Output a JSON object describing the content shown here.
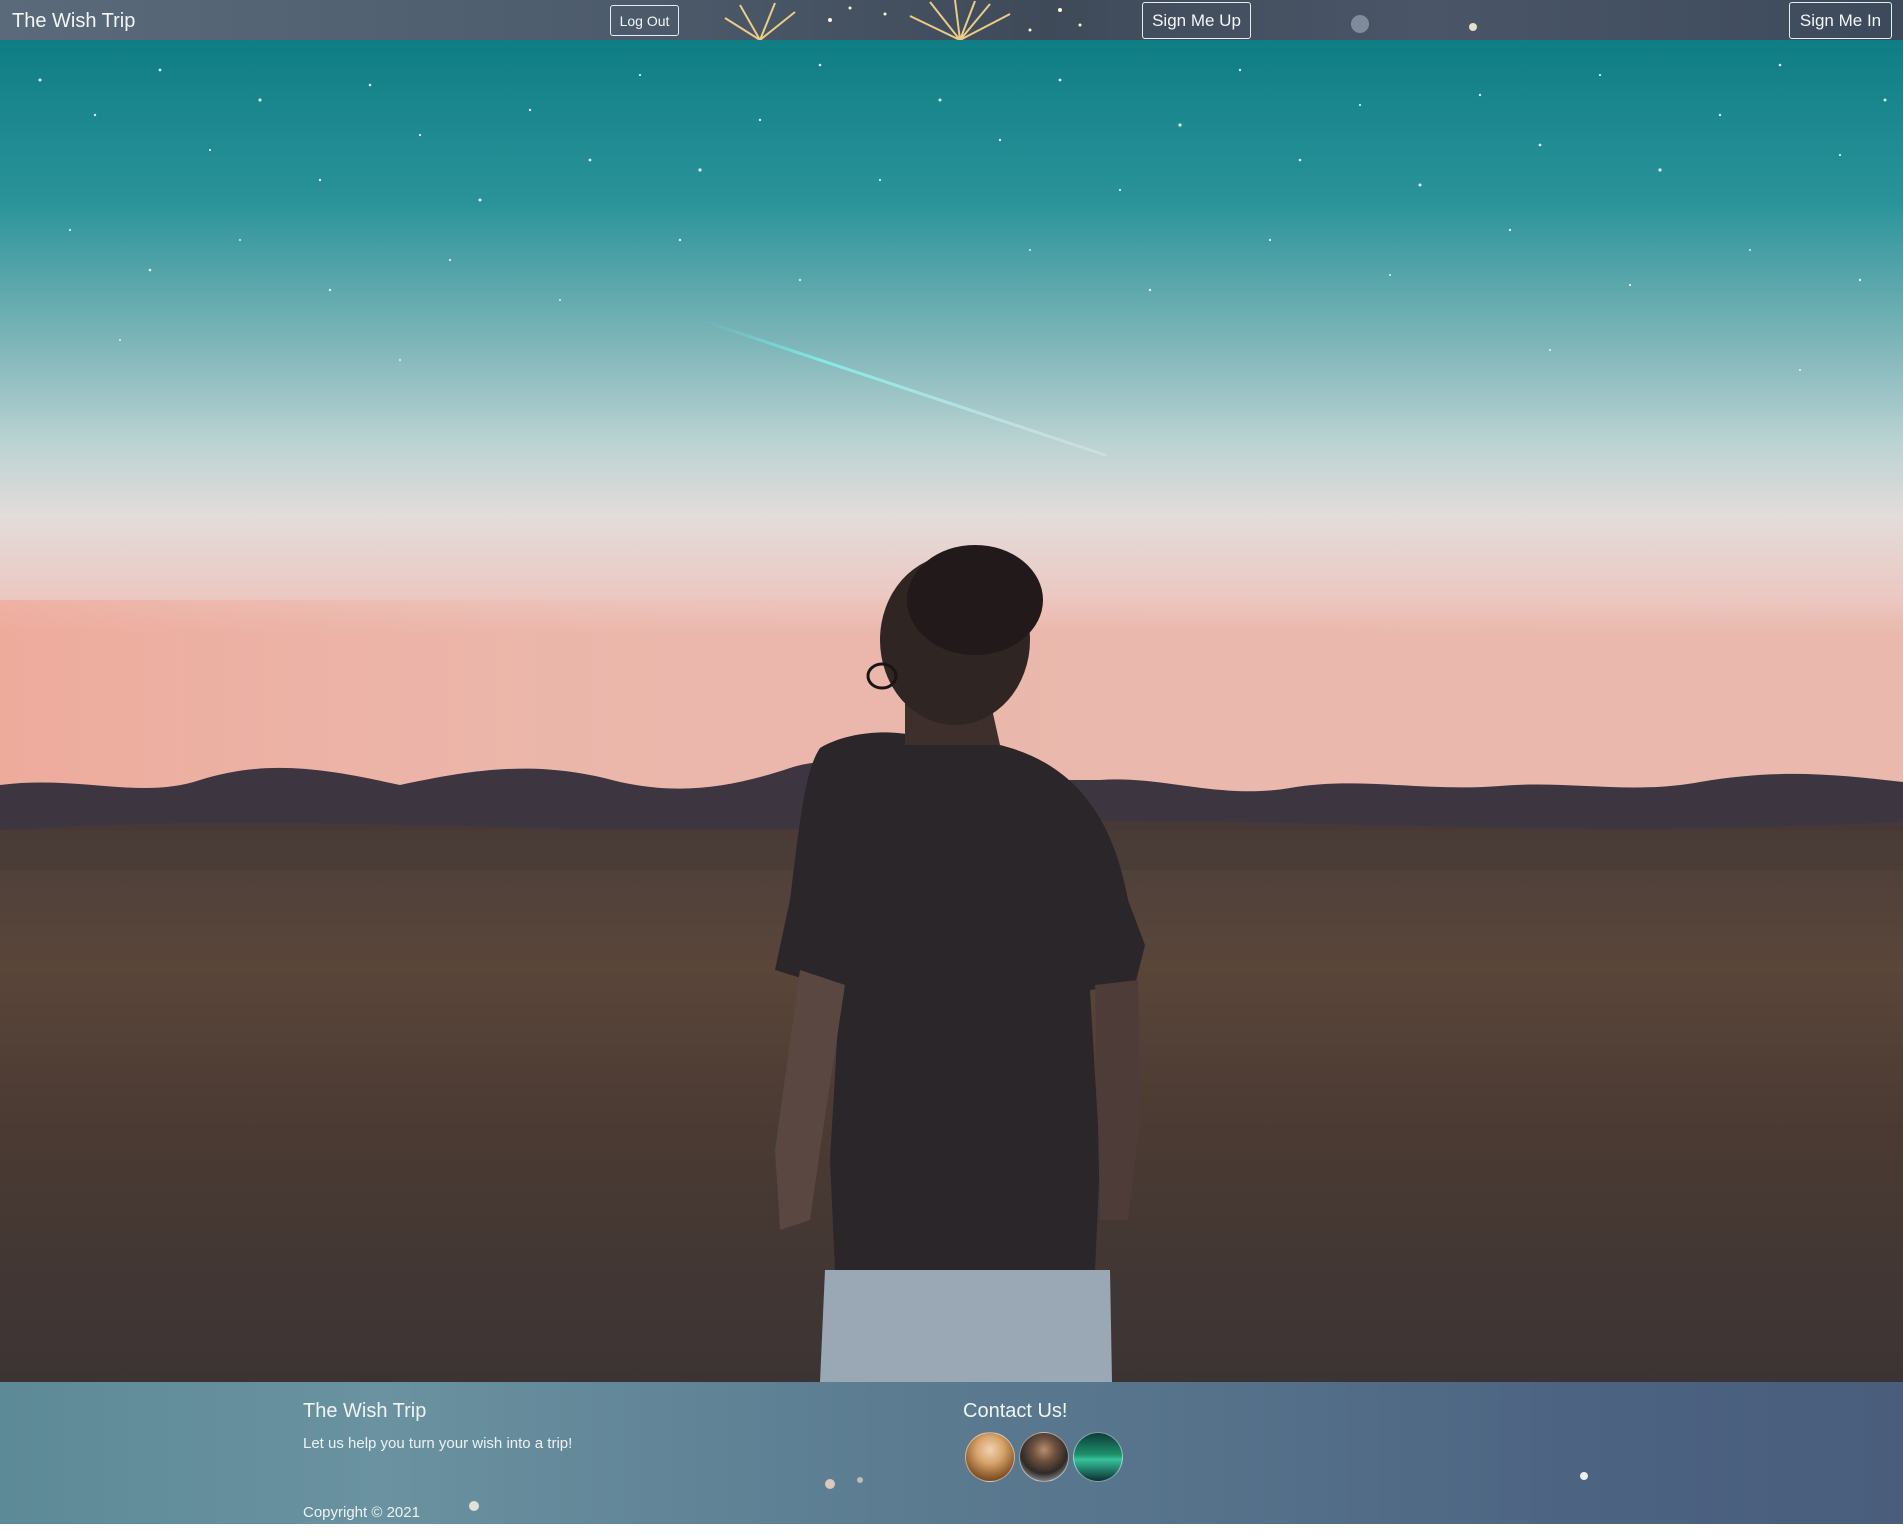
{
  "navbar": {
    "brand": "The Wish Trip",
    "logout_label": "Log Out",
    "signup_label": "Sign Me Up",
    "signin_label": "Sign Me In"
  },
  "hero": {
    "image": "man-looking-at-starry-sky-over-hills"
  },
  "footer": {
    "title": "The Wish Trip",
    "tagline": "Let us help you turn your wish into a trip!",
    "copyright": "Copyright © 2021",
    "contact_title": "Contact Us!",
    "contacts": [
      {
        "name": "contact-avatar-1"
      },
      {
        "name": "contact-avatar-2"
      },
      {
        "name": "contact-avatar-3"
      }
    ]
  },
  "colors": {
    "navbar_bg": "#4e5d6e",
    "footer_bg": "#5c7d92",
    "text": "#f3f5f7"
  }
}
